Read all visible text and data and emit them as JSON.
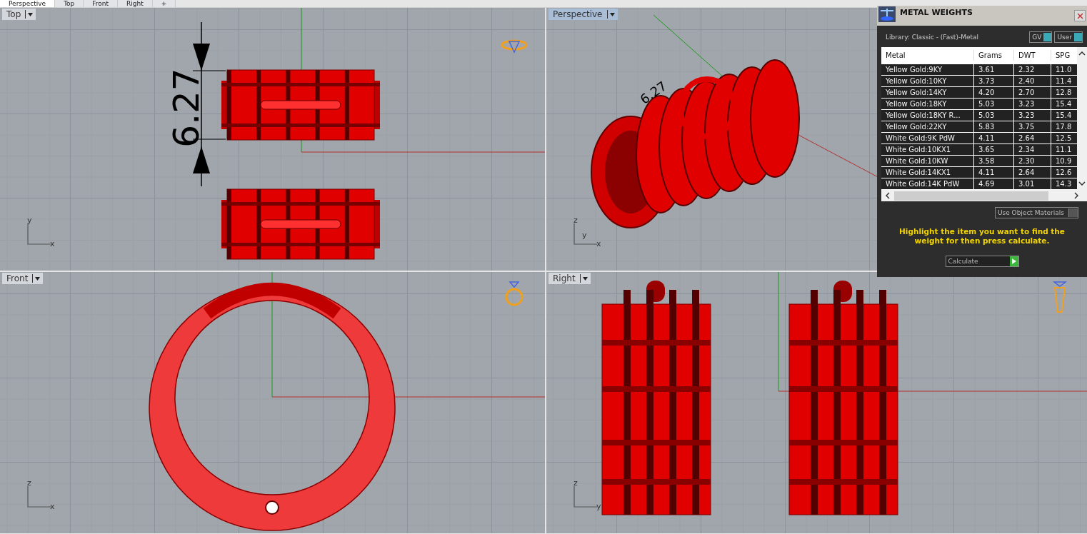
{
  "tabs": [
    {
      "label": "Perspective",
      "selected": true
    },
    {
      "label": "Top",
      "selected": false
    },
    {
      "label": "Front",
      "selected": false
    },
    {
      "label": "Right",
      "selected": false
    },
    {
      "label": "+",
      "selected": false
    }
  ],
  "viewports": [
    {
      "kind": "top",
      "label": "Top",
      "active": false,
      "dimension": "6.27",
      "axes": [
        "y",
        "x"
      ]
    },
    {
      "kind": "perspective",
      "label": "Perspective",
      "active": true,
      "dimension": "6.27",
      "axes": [
        "z",
        "y",
        "x"
      ]
    },
    {
      "kind": "front",
      "label": "Front",
      "active": false,
      "axes": [
        "z",
        "x"
      ]
    },
    {
      "kind": "right",
      "label": "Right",
      "active": false,
      "axes": [
        "z",
        "y"
      ]
    }
  ],
  "panel": {
    "title": "METAL WEIGHTS",
    "library": "Library: Classic - (Fast)-Metal",
    "toggles": [
      {
        "label": "GV",
        "on": true
      },
      {
        "label": "User",
        "on": true
      }
    ],
    "columns": [
      "Metal",
      "Grams",
      "DWT",
      "SPG"
    ],
    "rows": [
      [
        "Yellow Gold:9KY",
        "3.61",
        "2.32",
        "11.0"
      ],
      [
        "Yellow Gold:10KY",
        "3.73",
        "2.40",
        "11.4"
      ],
      [
        "Yellow Gold:14KY",
        "4.20",
        "2.70",
        "12.8"
      ],
      [
        "Yellow Gold:18KY",
        "5.03",
        "3.23",
        "15.4"
      ],
      [
        "Yellow Gold:18KY R...",
        "5.03",
        "3.23",
        "15.4"
      ],
      [
        "Yellow Gold:22KY",
        "5.83",
        "3.75",
        "17.8"
      ],
      [
        "White Gold:9K PdW",
        "4.11",
        "2.64",
        "12.5"
      ],
      [
        "White Gold:10KX1",
        "3.65",
        "2.34",
        "11.1"
      ],
      [
        "White Gold:10KW",
        "3.58",
        "2.30",
        "10.9"
      ],
      [
        "White Gold:14KX1",
        "4.11",
        "2.64",
        "12.6"
      ],
      [
        "White Gold:14K PdW",
        "4.69",
        "3.01",
        "14.3"
      ]
    ],
    "use_object_materials": {
      "label": "Use Object Materials",
      "checked": false
    },
    "message": "Highlight the item you want to find the weight for then press calculate.",
    "button": "Calculate"
  }
}
